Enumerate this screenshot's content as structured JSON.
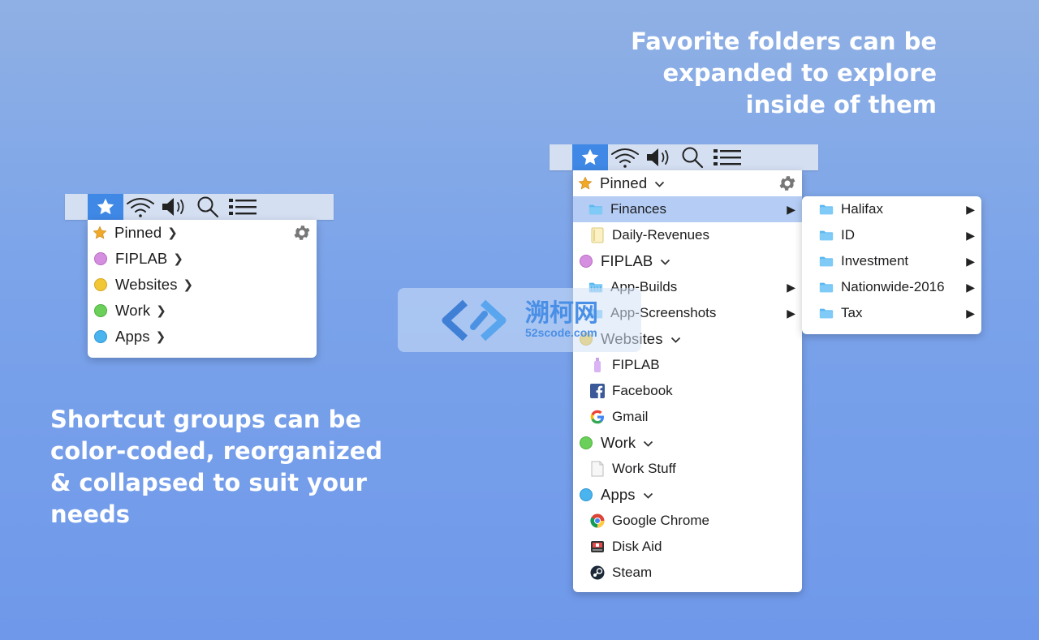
{
  "captions": {
    "left": "Shortcut groups can be color-coded, reorganized & collapsed to suit your needs",
    "right": "Favorite folders can be expanded to explore inside of them"
  },
  "colors": {
    "accent": "#3f88e6",
    "highlight": "#b5cdf5",
    "group_fiplab": "#d68fe0",
    "group_websites": "#f1c736",
    "group_work": "#6ad05a",
    "group_apps": "#4ab4ef",
    "pinned_star": "#f0a928"
  },
  "menubar_icons": [
    "star-icon",
    "wifi-icon",
    "volume-icon",
    "search-icon",
    "list-icon"
  ],
  "small_menu": {
    "groups": [
      {
        "label": "Pinned"
      },
      {
        "label": "FIPLAB"
      },
      {
        "label": "Websites"
      },
      {
        "label": "Work"
      },
      {
        "label": "Apps"
      }
    ]
  },
  "big_menu": {
    "pinned": {
      "label": "Pinned",
      "items": [
        {
          "label": "Finances"
        },
        {
          "label": "Daily-Revenues"
        }
      ]
    },
    "fiplab": {
      "label": "FIPLAB",
      "items": [
        {
          "label": "App-Builds"
        },
        {
          "label": "App-Screenshots"
        }
      ]
    },
    "websites": {
      "label": "Websites",
      "items": [
        {
          "label": "FIPLAB"
        },
        {
          "label": "Facebook"
        },
        {
          "label": "Gmail"
        }
      ]
    },
    "work": {
      "label": "Work",
      "items": [
        {
          "label": "Work Stuff"
        }
      ]
    },
    "apps": {
      "label": "Apps",
      "items": [
        {
          "label": "Google Chrome"
        },
        {
          "label": "Disk Aid"
        },
        {
          "label": "Steam"
        }
      ]
    }
  },
  "submenu": {
    "items": [
      {
        "label": "Halifax"
      },
      {
        "label": "ID"
      },
      {
        "label": "Investment"
      },
      {
        "label": "Nationwide-2016"
      },
      {
        "label": "Tax"
      }
    ]
  },
  "watermark": {
    "text": "溯柯网",
    "sub": "52scode.com"
  }
}
